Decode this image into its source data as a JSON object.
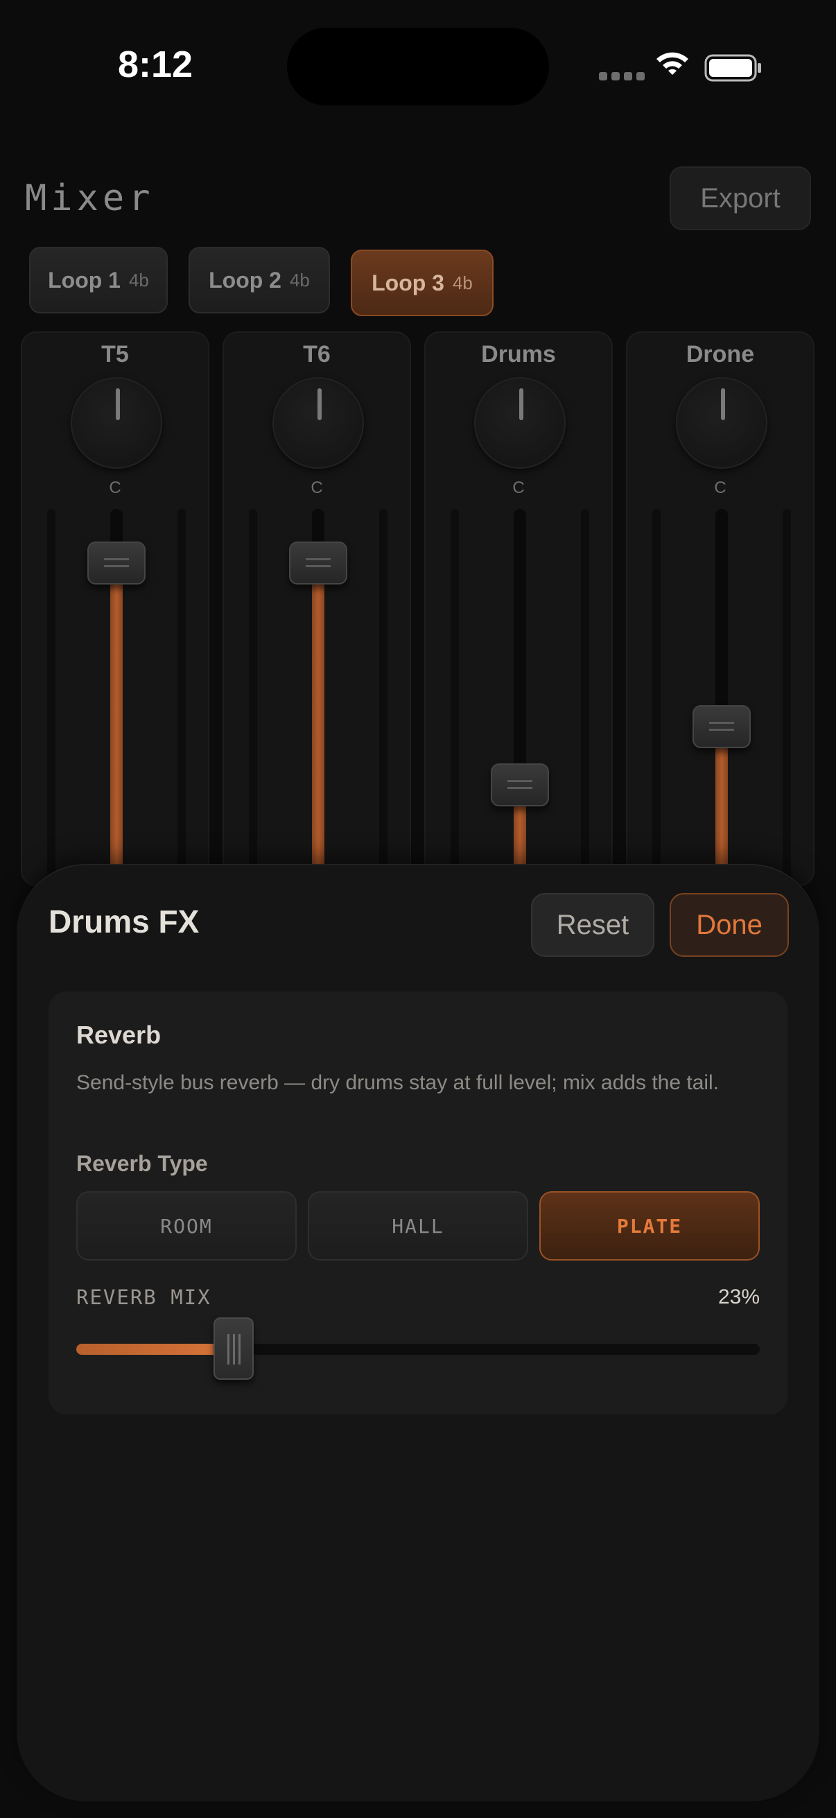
{
  "status_bar": {
    "time": "8:12"
  },
  "mixer": {
    "title": "Mixer",
    "export_label": "Export",
    "loops": [
      {
        "label": "Loop 1",
        "beats": "4b",
        "active": false
      },
      {
        "label": "Loop 2",
        "beats": "4b",
        "active": false
      },
      {
        "label": "Loop 3",
        "beats": "4b",
        "active": true
      }
    ],
    "channels": [
      {
        "name": "T5",
        "pan": "C",
        "level": 0.86
      },
      {
        "name": "T6",
        "pan": "C",
        "level": 0.86
      },
      {
        "name": "Drums",
        "pan": "C",
        "level": 0.29
      },
      {
        "name": "Drone",
        "pan": "C",
        "level": 0.44
      }
    ]
  },
  "fx_sheet": {
    "title": "Drums FX",
    "reset_label": "Reset",
    "done_label": "Done",
    "reverb": {
      "heading": "Reverb",
      "description": "Send-style bus reverb — dry drums stay at full level; mix adds the tail.",
      "type_label": "Reverb Type",
      "types": [
        "ROOM",
        "HALL",
        "PLATE"
      ],
      "selected_type": "PLATE",
      "mix_label": "REVERB MIX",
      "mix_value": "23%",
      "mix_fraction": 0.23
    }
  },
  "colors": {
    "accent": "#e2783c",
    "background": "#0c0c0c"
  }
}
